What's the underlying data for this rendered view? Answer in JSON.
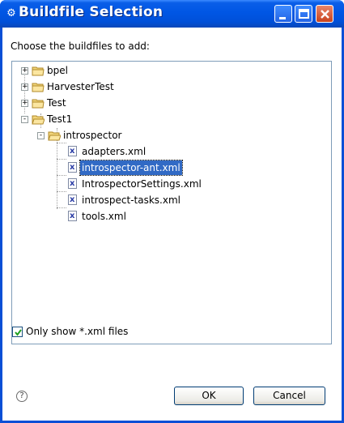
{
  "window": {
    "title": "Buildfile Selection",
    "icon": "eclipse-icon"
  },
  "prompt": "Choose the buildfiles to add:",
  "tree": {
    "items": [
      {
        "label": "bpel",
        "type": "folder",
        "expander": "+"
      },
      {
        "label": "HarvesterTest",
        "type": "folder",
        "expander": "+"
      },
      {
        "label": "Test",
        "type": "folder",
        "expander": "+"
      },
      {
        "label": "Test1",
        "type": "folder",
        "expander": "-"
      },
      {
        "label": "introspector",
        "type": "folder",
        "expander": "-"
      },
      {
        "label": "adapters.xml",
        "type": "file"
      },
      {
        "label": "introspector-ant.xml",
        "type": "file",
        "selected": true
      },
      {
        "label": "IntrospectorSettings.xml",
        "type": "file"
      },
      {
        "label": "introspect-tasks.xml",
        "type": "file"
      },
      {
        "label": "tools.xml",
        "type": "file"
      }
    ]
  },
  "filter": {
    "label": "Only show *.xml files",
    "checked": true
  },
  "buttons": {
    "ok": "OK",
    "cancel": "Cancel",
    "help": "?"
  },
  "colors": {
    "selection": "#316ac5",
    "titlebar": "#0054e3",
    "close": "#c8421c"
  }
}
